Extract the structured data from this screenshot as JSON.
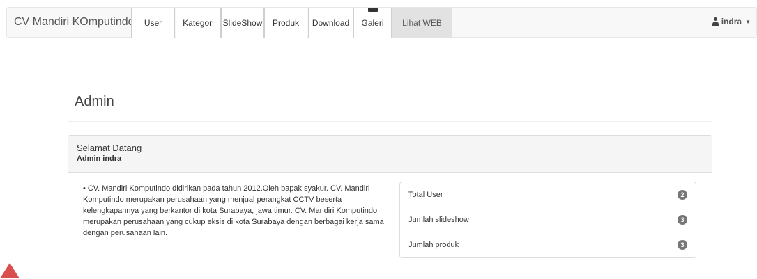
{
  "navbar": {
    "brand": "CV Mandiri KOmputindo",
    "items": [
      {
        "label": "User"
      },
      {
        "label": "Kategori"
      },
      {
        "label": "SlideShow"
      },
      {
        "label": "Produk"
      },
      {
        "label": "Download"
      },
      {
        "label": "Galeri"
      },
      {
        "label": "Lihat WEB"
      }
    ],
    "user_label": "indra",
    "user_icon": "user-icon",
    "caret_icon": "caret-down-icon"
  },
  "page": {
    "title": "Admin"
  },
  "panel": {
    "title": "Selamat Datang",
    "subtitle": "Admin indra",
    "about": "CV. Mandiri Komputindo didirikan pada tahun 2012.Oleh bapak syakur. CV. Mandiri Komputindo merupakan perusahaan yang menjual perangkat CCTV beserta kelengkapannya yang berkantor di kota Surabaya, jawa timur. CV. Mandiri Komputindo merupakan perusahaan yang cukup eksis di kota Surabaya dengan berbagai kerja sama dengan perusahaan lain.",
    "stats": [
      {
        "label": "Total User",
        "count": "2"
      },
      {
        "label": "Jumlah slideshow",
        "count": "3"
      },
      {
        "label": "Jumlah produk",
        "count": "3"
      }
    ]
  },
  "colors": {
    "navbar_bg": "#f8f8f8",
    "active_tab_bg": "#e2e2e2",
    "badge_bg": "#777777",
    "panel_heading_bg": "#f5f5f5"
  }
}
